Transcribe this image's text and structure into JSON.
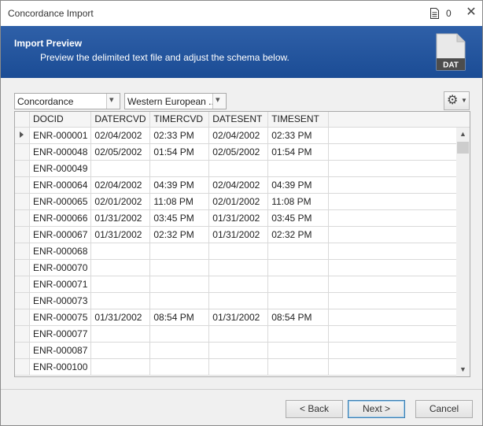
{
  "window": {
    "title": "Concordance Import",
    "doc_count": "0",
    "close_glyph": "✕"
  },
  "banner": {
    "heading": "Import Preview",
    "subtitle": "Preview the delimited text file and adjust the schema below.",
    "file_icon_label": "DAT"
  },
  "toolbar": {
    "format_select": "Concordance",
    "encoding_select": "Western European ...",
    "settings_icon": "gear-icon"
  },
  "grid": {
    "columns": [
      "DOCID",
      "DATERCVD",
      "TIMERCVD",
      "DATESENT",
      "TIMESENT"
    ],
    "rows": [
      [
        "ENR-000001",
        "02/04/2002",
        "02:33 PM",
        "02/04/2002",
        "02:33 PM"
      ],
      [
        "ENR-000048",
        "02/05/2002",
        "01:54 PM",
        "02/05/2002",
        "01:54 PM"
      ],
      [
        "ENR-000049",
        "",
        "",
        "",
        ""
      ],
      [
        "ENR-000064",
        "02/04/2002",
        "04:39 PM",
        "02/04/2002",
        "04:39 PM"
      ],
      [
        "ENR-000065",
        "02/01/2002",
        "11:08 PM",
        "02/01/2002",
        "11:08 PM"
      ],
      [
        "ENR-000066",
        "01/31/2002",
        "03:45 PM",
        "01/31/2002",
        "03:45 PM"
      ],
      [
        "ENR-000067",
        "01/31/2002",
        "02:32 PM",
        "01/31/2002",
        "02:32 PM"
      ],
      [
        "ENR-000068",
        "",
        "",
        "",
        ""
      ],
      [
        "ENR-000070",
        "",
        "",
        "",
        ""
      ],
      [
        "ENR-000071",
        "",
        "",
        "",
        ""
      ],
      [
        "ENR-000073",
        "",
        "",
        "",
        ""
      ],
      [
        "ENR-000075",
        "01/31/2002",
        "08:54 PM",
        "01/31/2002",
        "08:54 PM"
      ],
      [
        "ENR-000077",
        "",
        "",
        "",
        ""
      ],
      [
        "ENR-000087",
        "",
        "",
        "",
        ""
      ],
      [
        "ENR-000100",
        "",
        "",
        "",
        ""
      ]
    ]
  },
  "footer": {
    "back_label": "< Back",
    "next_label": "Next >",
    "cancel_label": "Cancel"
  }
}
